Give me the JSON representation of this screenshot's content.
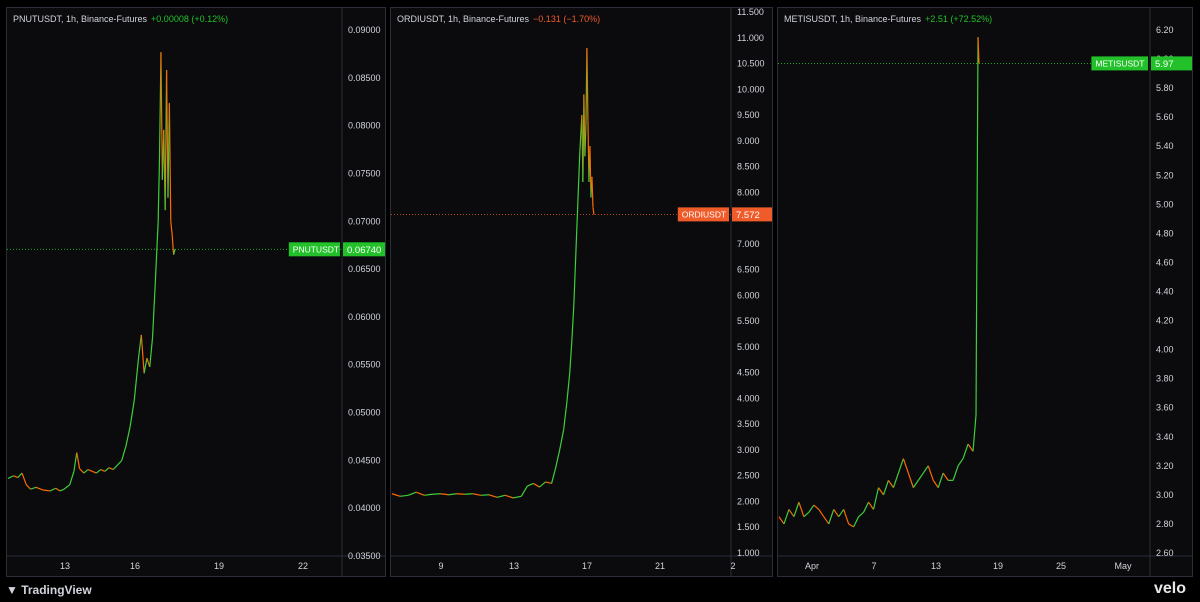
{
  "panels": [
    {
      "symbol": "PNUTUSDT",
      "header": "PNUTUSDT, 1h, Binance-Futures",
      "change_text": "+0.00008 (+0.12%)",
      "change_color": "#22c12a",
      "price_label": "0.06740",
      "label_color": "#22c12a",
      "y_ticks": [
        "0.09000",
        "0.08500",
        "0.08000",
        "0.07500",
        "0.07000",
        "0.06500",
        "0.06000",
        "0.05500",
        "0.05000",
        "0.04500",
        "0.04000",
        "0.03500"
      ],
      "x_ticks": [
        "13",
        "16",
        "19",
        "22"
      ],
      "chart_data": {
        "type": "line",
        "title": "PNUTUSDT, 1h, Binance-Futures",
        "ylim": [
          0.033,
          0.092
        ],
        "last_price": 0.0674,
        "series": [
          {
            "name": "PNUTUSDT",
            "points": [
              [
                0,
                0.0417
              ],
              [
                4,
                0.042
              ],
              [
                7,
                0.0418
              ],
              [
                10,
                0.0423
              ],
              [
                13,
                0.041
              ],
              [
                16,
                0.0405
              ],
              [
                20,
                0.0407
              ],
              [
                25,
                0.0404
              ],
              [
                30,
                0.0403
              ],
              [
                34,
                0.0406
              ],
              [
                37,
                0.0403
              ],
              [
                40,
                0.0405
              ],
              [
                44,
                0.041
              ],
              [
                47,
                0.0425
              ],
              [
                49,
                0.0446
              ],
              [
                51,
                0.0428
              ],
              [
                54,
                0.0423
              ],
              [
                57,
                0.0427
              ],
              [
                60,
                0.0425
              ],
              [
                63,
                0.0423
              ],
              [
                66,
                0.0427
              ],
              [
                69,
                0.0425
              ],
              [
                72,
                0.0429
              ],
              [
                75,
                0.0427
              ],
              [
                78,
                0.0432
              ],
              [
                81,
                0.0437
              ],
              [
                84,
                0.0453
              ],
              [
                87,
                0.0475
              ],
              [
                90,
                0.0505
              ],
              [
                93,
                0.0552
              ],
              [
                95,
                0.0578
              ],
              [
                97,
                0.0535
              ],
              [
                99,
                0.0552
              ],
              [
                101,
                0.0542
              ],
              [
                103,
                0.0575
              ],
              [
                105,
                0.0638
              ],
              [
                107,
                0.0705
              ],
              [
                108,
                0.078
              ],
              [
                109,
                0.0895
              ],
              [
                110,
                0.0752
              ],
              [
                111,
                0.0808
              ],
              [
                112,
                0.0718
              ],
              [
                113,
                0.0875
              ],
              [
                114,
                0.0732
              ],
              [
                115,
                0.0838
              ],
              [
                116,
                0.0705
              ],
              [
                117,
                0.069
              ],
              [
                118,
                0.0668
              ],
              [
                119,
                0.0674
              ]
            ]
          }
        ]
      }
    },
    {
      "symbol": "ORDIUSDT",
      "header": "ORDIUSDT, 1h, Binance-Futures",
      "change_text": "−0.131 (−1.70%)",
      "change_color": "#f05b2a",
      "price_label": "7.572",
      "label_color": "#f05b2a",
      "y_ticks": [
        "11.500",
        "11.000",
        "10.500",
        "10.000",
        "9.500",
        "9.000",
        "8.500",
        "8.000",
        "7.500",
        "7.000",
        "6.500",
        "6.000",
        "5.500",
        "5.000",
        "4.500",
        "4.000",
        "3.500",
        "3.000",
        "2.500",
        "2.000",
        "1.500",
        "1.000"
      ],
      "x_ticks": [
        "9",
        "13",
        "17",
        "21",
        "2"
      ],
      "chart_data": {
        "type": "line",
        "title": "ORDIUSDT, 1h, Binance-Futures",
        "ylim": [
          1.0,
          11.5
        ],
        "last_price": 7.572,
        "series": [
          {
            "name": "ORDIUSDT",
            "points": [
              [
                0,
                2.15
              ],
              [
                8,
                2.1
              ],
              [
                16,
                2.12
              ],
              [
                24,
                2.18
              ],
              [
                32,
                2.12
              ],
              [
                40,
                2.14
              ],
              [
                48,
                2.15
              ],
              [
                56,
                2.13
              ],
              [
                64,
                2.15
              ],
              [
                72,
                2.14
              ],
              [
                80,
                2.15
              ],
              [
                88,
                2.12
              ],
              [
                96,
                2.13
              ],
              [
                104,
                2.08
              ],
              [
                112,
                2.12
              ],
              [
                120,
                2.07
              ],
              [
                128,
                2.1
              ],
              [
                134,
                2.3
              ],
              [
                140,
                2.35
              ],
              [
                146,
                2.28
              ],
              [
                152,
                2.38
              ],
              [
                158,
                2.35
              ],
              [
                162,
                2.65
              ],
              [
                166,
                3.0
              ],
              [
                170,
                3.4
              ],
              [
                173,
                3.9
              ],
              [
                176,
                4.5
              ],
              [
                178,
                5.1
              ],
              [
                180,
                5.8
              ],
              [
                182,
                6.8
              ],
              [
                184,
                7.8
              ],
              [
                186,
                8.8
              ],
              [
                188,
                9.5
              ],
              [
                189,
                8.2
              ],
              [
                190,
                9.9
              ],
              [
                191,
                8.7
              ],
              [
                192,
                9.3
              ],
              [
                193,
                10.8
              ],
              [
                194,
                9.4
              ],
              [
                195,
                8.2
              ],
              [
                196,
                8.9
              ],
              [
                197,
                7.9
              ],
              [
                198,
                8.3
              ],
              [
                199,
                7.7
              ],
              [
                200,
                7.57
              ]
            ]
          }
        ]
      }
    },
    {
      "symbol": "METISUSDT",
      "header": "METISUSDT, 1h, Binance-Futures",
      "change_text": "+2.51 (+72.52%)",
      "change_color": "#22c12a",
      "price_label": "5.97",
      "label_color": "#22c12a",
      "y_ticks": [
        "6.20",
        "6.00",
        "5.80",
        "5.60",
        "5.40",
        "5.20",
        "5.00",
        "4.80",
        "4.60",
        "4.40",
        "4.20",
        "4.00",
        "3.80",
        "3.60",
        "3.40",
        "3.20",
        "3.00",
        "2.80",
        "2.60"
      ],
      "x_ticks": [
        "Apr",
        "7",
        "13",
        "19",
        "25",
        "May"
      ],
      "chart_data": {
        "type": "line",
        "title": "METISUSDT, 1h, Binance-Futures",
        "ylim": [
          2.6,
          6.2
        ],
        "last_price": 5.97,
        "series": [
          {
            "name": "METISUSDT",
            "points": [
              [
                0,
                2.85
              ],
              [
                5,
                2.8
              ],
              [
                10,
                2.9
              ],
              [
                15,
                2.85
              ],
              [
                20,
                2.95
              ],
              [
                25,
                2.85
              ],
              [
                30,
                2.88
              ],
              [
                35,
                2.93
              ],
              [
                40,
                2.9
              ],
              [
                45,
                2.85
              ],
              [
                50,
                2.8
              ],
              [
                55,
                2.9
              ],
              [
                60,
                2.85
              ],
              [
                65,
                2.9
              ],
              [
                70,
                2.8
              ],
              [
                75,
                2.78
              ],
              [
                80,
                2.85
              ],
              [
                85,
                2.88
              ],
              [
                90,
                2.95
              ],
              [
                95,
                2.9
              ],
              [
                100,
                3.05
              ],
              [
                105,
                3.0
              ],
              [
                110,
                3.1
              ],
              [
                115,
                3.05
              ],
              [
                120,
                3.15
              ],
              [
                125,
                3.25
              ],
              [
                130,
                3.15
              ],
              [
                135,
                3.05
              ],
              [
                140,
                3.1
              ],
              [
                145,
                3.15
              ],
              [
                150,
                3.2
              ],
              [
                155,
                3.1
              ],
              [
                160,
                3.05
              ],
              [
                165,
                3.15
              ],
              [
                170,
                3.1
              ],
              [
                175,
                3.1
              ],
              [
                180,
                3.2
              ],
              [
                185,
                3.25
              ],
              [
                190,
                3.35
              ],
              [
                195,
                3.3
              ],
              [
                198,
                3.55
              ],
              [
                200,
                6.15
              ],
              [
                201,
                5.97
              ]
            ]
          }
        ]
      }
    }
  ],
  "footer": {
    "left_logo": "TradingView",
    "right_logo": "velo"
  }
}
